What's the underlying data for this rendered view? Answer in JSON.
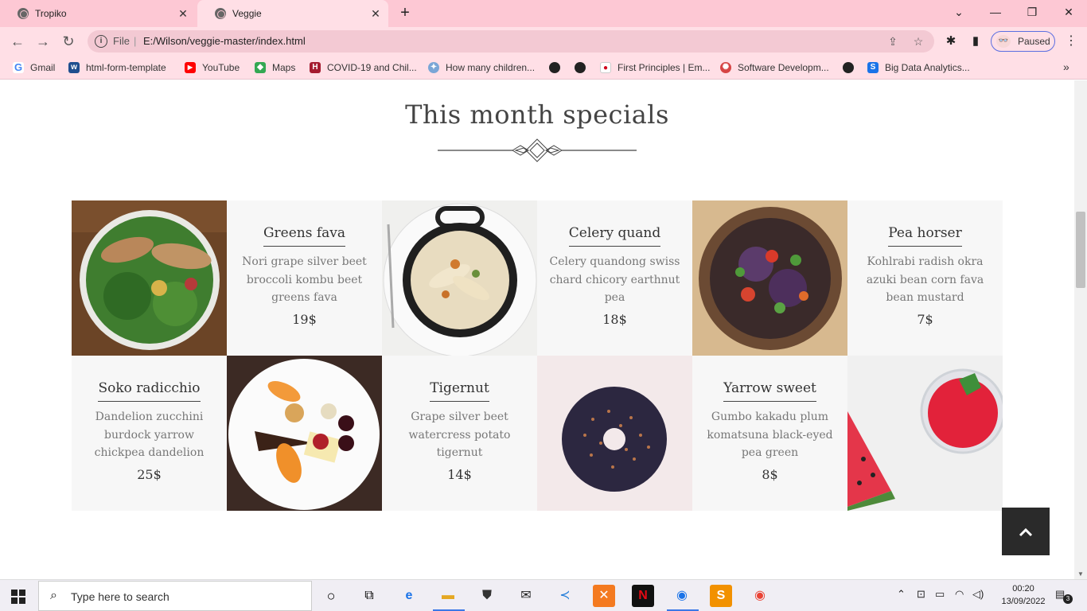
{
  "browser": {
    "tabs": [
      {
        "title": "Tropiko",
        "active": false
      },
      {
        "title": "Veggie",
        "active": true
      }
    ],
    "new_tab_icon": "plus-icon",
    "address": {
      "protocol_label": "File",
      "url": "E:/Wilson/veggie-master/index.html"
    },
    "profile_label": "Paused",
    "bookmarks": [
      {
        "label": "Gmail",
        "icon": "google-icon",
        "color": "#4285f4"
      },
      {
        "label": "html-form-template",
        "icon": "w3-icon",
        "color": "#1f4f8f"
      },
      {
        "label": "YouTube",
        "icon": "youtube-icon",
        "color": "#ff0000"
      },
      {
        "label": "Maps",
        "icon": "maps-icon",
        "color": "#34a853"
      },
      {
        "label": "COVID-19 and Chil...",
        "icon": "harvard-icon",
        "color": "#a51c30"
      },
      {
        "label": "How many children...",
        "icon": "globe-icon",
        "color": "#7aa6d6"
      },
      {
        "label": "First Principles | Em...",
        "icon": "flag-icon",
        "color": "#d0021b"
      },
      {
        "label": "Software Developm...",
        "icon": "circle-icon",
        "color": "#d64545"
      },
      {
        "label": "Big Data Analytics...",
        "icon": "s-icon",
        "color": "#1a73e8"
      }
    ]
  },
  "page": {
    "section_title": "This month specials",
    "items": [
      {
        "name": "Greens fava",
        "desc": "Nori grape silver beet broccoli kombu beet greens fava",
        "price": "19$"
      },
      {
        "name": "Celery quand",
        "desc": "Celery quandong swiss chard chicory earthnut pea",
        "price": "18$"
      },
      {
        "name": "Pea horser",
        "desc": "Kohlrabi radish okra azuki bean corn fava bean mustard",
        "price": "7$"
      },
      {
        "name": "Soko radicchio",
        "desc": "Dandelion zucchini burdock yarrow chickpea dandelion",
        "price": "25$"
      },
      {
        "name": "Tigernut",
        "desc": "Grape silver beet watercress potato tigernut",
        "price": "14$"
      },
      {
        "name": "Yarrow sweet",
        "desc": "Gumbo kakadu plum komatsuna black-eyed pea green",
        "price": "8$"
      }
    ],
    "images": [
      {
        "name": "salad-photo"
      },
      {
        "name": "pasta-pot-photo"
      },
      {
        "name": "vegetable-bowl-photo"
      },
      {
        "name": "fruit-dessert-plate-photo"
      },
      {
        "name": "chocolate-donut-photo"
      },
      {
        "name": "watermelon-smoothie-photo"
      }
    ],
    "back_to_top_icon": "chevron-up-icon"
  },
  "taskbar": {
    "search_placeholder": "Type here to search",
    "time": "00:20",
    "date": "13/09/2022",
    "notification_count": "3"
  }
}
